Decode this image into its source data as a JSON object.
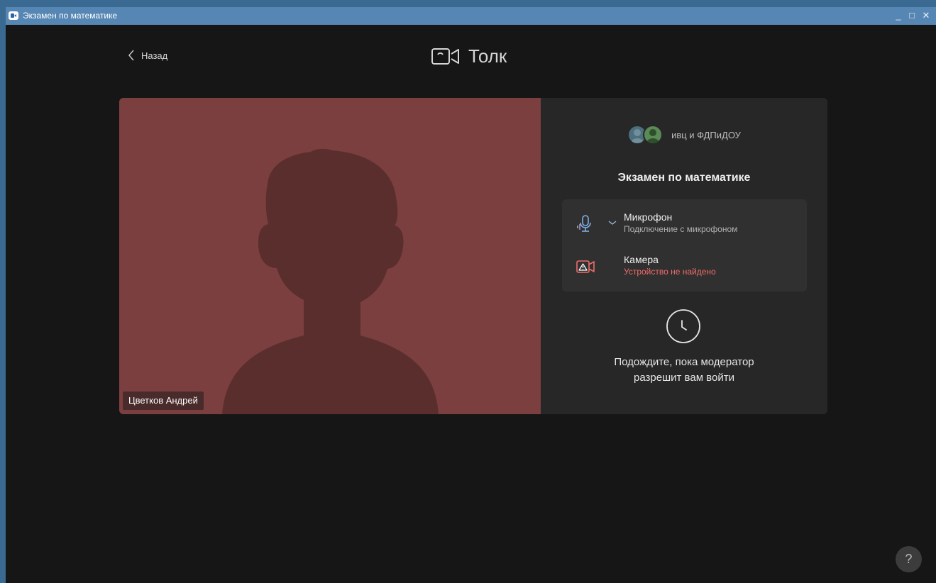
{
  "window": {
    "title": "Экзамен по математике",
    "controls": {
      "minimize": "_",
      "maximize": "□",
      "close": "✕"
    }
  },
  "header": {
    "back_label": "Назад",
    "brand": "Толк"
  },
  "video": {
    "participant_name": "Цветков Андрей",
    "background_color": "#7b3f3f"
  },
  "panel": {
    "organization": "ивц и ФДПиДОУ",
    "meeting_title": "Экзамен по математике",
    "devices": [
      {
        "label": "Микрофон",
        "status": "Подключение с микрофоном",
        "icon": "microphone-icon"
      },
      {
        "label": "Камера",
        "status": "Устройство не найдено",
        "icon": "camera-warning-icon",
        "status_color": "#ef6b6b"
      }
    ],
    "wait_line1": "Подождите, пока модератор",
    "wait_line2": "разрешит вам войти"
  },
  "help": {
    "label": "?"
  },
  "colors": {
    "titlebar": "#5686b3",
    "background": "#161616",
    "panel": "#272727",
    "error": "#ef6b6b"
  }
}
